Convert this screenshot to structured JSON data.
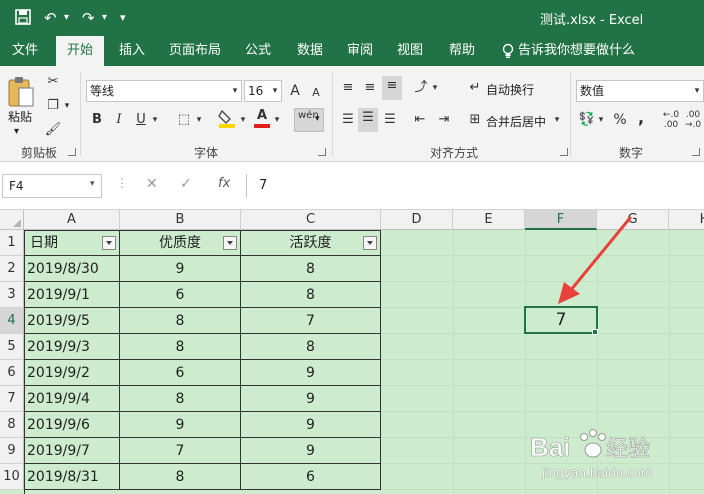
{
  "titlebar": {
    "title": "测试.xlsx  -  Excel",
    "icons": [
      "save-icon",
      "undo-icon",
      "redo-icon",
      "customize-qat-icon"
    ]
  },
  "tabs": [
    {
      "label": "文件"
    },
    {
      "label": "开始",
      "active": true
    },
    {
      "label": "插入"
    },
    {
      "label": "页面布局"
    },
    {
      "label": "公式"
    },
    {
      "label": "数据"
    },
    {
      "label": "审阅"
    },
    {
      "label": "视图"
    },
    {
      "label": "帮助"
    },
    {
      "label": "告诉我你想要做什么"
    }
  ],
  "ribbon": {
    "clipboard": {
      "paste_label": "粘贴",
      "group_label": "剪贴板"
    },
    "font": {
      "font_name": "等线",
      "font_size": "16",
      "group_label": "字体",
      "grow_label": "A",
      "shrink_label": "A",
      "phonetic_label": "wén"
    },
    "alignment": {
      "wrap_label": "自动换行",
      "merge_label": "合并后居中",
      "group_label": "对齐方式"
    },
    "number": {
      "format": "数值",
      "group_label": "数字",
      "percent_label": "%",
      "comma_label": ","
    }
  },
  "formula_bar": {
    "name_box": "F4",
    "fx_label": "fx",
    "content": "7"
  },
  "sheet": {
    "columns": [
      "A",
      "B",
      "C",
      "D",
      "E",
      "F",
      "G",
      "H"
    ],
    "rows": [
      "1",
      "2",
      "3",
      "4",
      "5",
      "6",
      "7",
      "8",
      "9",
      "10"
    ],
    "headers": [
      "日期",
      "优质度",
      "活跃度"
    ],
    "data": [
      [
        "2019/8/30",
        "9",
        "8"
      ],
      [
        "2019/9/1",
        "6",
        "8"
      ],
      [
        "2019/9/5",
        "8",
        "7"
      ],
      [
        "2019/9/3",
        "8",
        "8"
      ],
      [
        "2019/9/2",
        "6",
        "9"
      ],
      [
        "2019/9/4",
        "8",
        "9"
      ],
      [
        "2019/9/6",
        "9",
        "9"
      ],
      [
        "2019/9/7",
        "7",
        "9"
      ],
      [
        "2019/8/31",
        "8",
        "6"
      ]
    ],
    "active_cell_value": "7",
    "selected_column": "F",
    "selected_row": "4"
  },
  "watermark": {
    "text": "Baidu经验",
    "url": "jingyan.baidu.com"
  },
  "colors": {
    "accent": "#217346",
    "sheet_bg": "#cdeccd",
    "arrow": "#e8403a"
  }
}
